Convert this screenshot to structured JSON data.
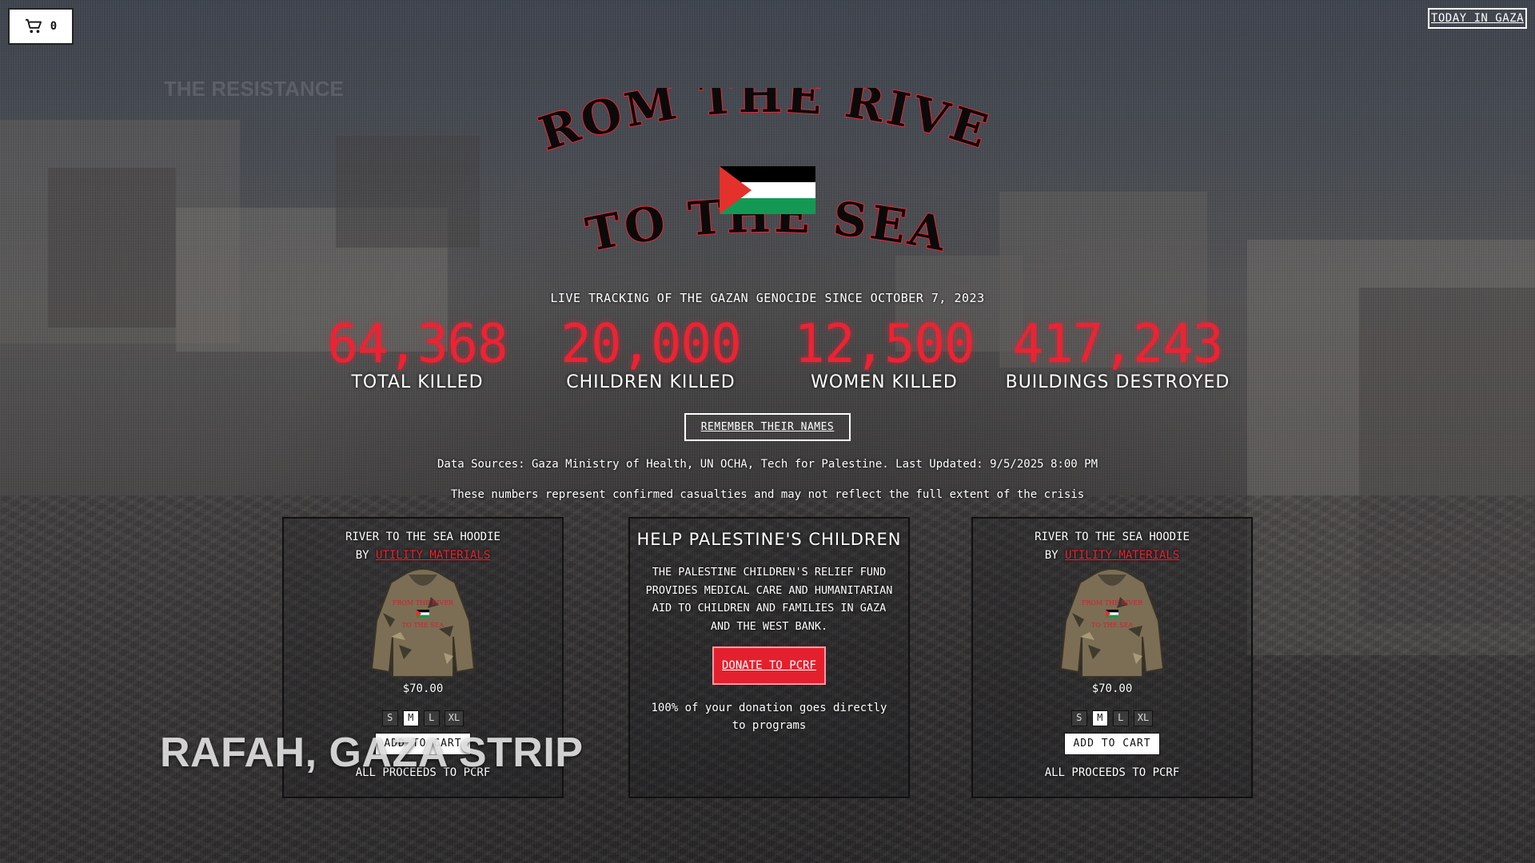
{
  "header": {
    "cart_count": "0",
    "today_label": "TODAY IN GAZA"
  },
  "hero": {
    "title_top": "FROM THE RIVER",
    "title_bottom": "TO THE SEA",
    "subtitle": "LIVE TRACKING OF THE GAZAN GENOCIDE SINCE OCTOBER 7, 2023"
  },
  "stats": [
    {
      "value": "64,368",
      "label": "TOTAL KILLED"
    },
    {
      "value": "20,000",
      "label": "CHILDREN KILLED"
    },
    {
      "value": "12,500",
      "label": "WOMEN KILLED"
    },
    {
      "value": "417,243",
      "label": "BUILDINGS DESTROYED"
    }
  ],
  "names_button": "REMEMBER THEIR NAMES",
  "sources": "Data Sources: Gaza Ministry of Health, UN OCHA, Tech for Palestine. Last Updated: 9/5/2025 8:00 PM",
  "disclaimer": "These numbers represent confirmed casualties and may not reflect the full extent of the crisis",
  "products": [
    {
      "name": "RIVER TO THE SEA HOODIE",
      "by": "BY ",
      "brand": "UTILITY MATERIALS",
      "price": "$70.00",
      "sizes": [
        "S",
        "M",
        "L",
        "XL"
      ],
      "selected_size": "M",
      "add_label": "ADD TO CART",
      "proceeds": "ALL PROCEEDS TO PCRF"
    },
    {
      "name": "RIVER TO THE SEA HOODIE",
      "by": "BY ",
      "brand": "UTILITY MATERIALS",
      "price": "$70.00",
      "sizes": [
        "S",
        "M",
        "L",
        "XL"
      ],
      "selected_size": "M",
      "add_label": "ADD TO CART",
      "proceeds": "ALL PROCEEDS TO PCRF"
    }
  ],
  "donate": {
    "title": "HELP PALESTINE'S CHILDREN",
    "description": "THE PALESTINE CHILDREN'S RELIEF FUND PROVIDES MEDICAL CARE AND HUMANITARIAN AID TO CHILDREN AND FAMILIES IN GAZA AND THE WEST BANK.",
    "button": "DONATE TO PCRF",
    "note": "100% of your donation goes directly to programs"
  },
  "location": "RAFAH, GAZA STRIP",
  "colors": {
    "accent_red": "#ee2233",
    "flag_black": "#000000",
    "flag_white": "#ffffff",
    "flag_green": "#149954",
    "flag_red": "#e4312b"
  }
}
